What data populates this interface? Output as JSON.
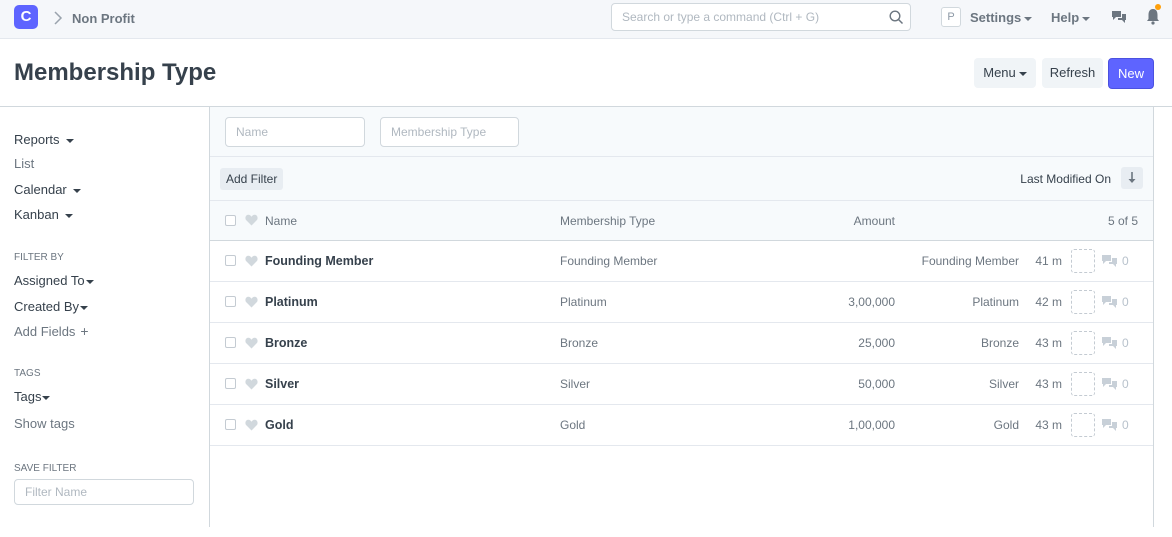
{
  "navbar": {
    "logo_letter": "C",
    "breadcrumb": "Non Profit",
    "search_placeholder": "Search or type a command (Ctrl + G)",
    "avatar_letter": "P",
    "settings_label": "Settings",
    "help_label": "Help",
    "icons": [
      "chevron-right-icon",
      "search-icon",
      "chat-icon",
      "bell-icon"
    ],
    "notification_dot_color": "#ffa00a"
  },
  "page": {
    "title": "Membership Type",
    "menu_label": "Menu",
    "refresh_label": "Refresh",
    "new_label": "New",
    "primary_color": "#5e64ff"
  },
  "sidebar": {
    "reports": "Reports",
    "list": "List",
    "calendar": "Calendar",
    "kanban": "Kanban",
    "filter_by_heading": "FILTER BY",
    "assigned_to": "Assigned To",
    "created_by": "Created By",
    "add_fields": "Add Fields",
    "tags_heading": "TAGS",
    "tags": "Tags",
    "show_tags": "Show tags",
    "save_filter_heading": "SAVE FILTER",
    "filter_name_placeholder": "Filter Name"
  },
  "filters": {
    "name_placeholder": "Name",
    "membership_type_placeholder": "Membership Type",
    "add_filter": "Add Filter",
    "sort_label": "Last Modified On"
  },
  "list": {
    "columns": {
      "name": "Name",
      "membership_type": "Membership Type",
      "amount": "Amount"
    },
    "count": "5 of 5",
    "rows": [
      {
        "name": "Founding Member",
        "membership_type": "Founding Member",
        "amount": "",
        "title": "Founding Member",
        "modified": "41 m",
        "comments": "0"
      },
      {
        "name": "Platinum",
        "membership_type": "Platinum",
        "amount": "3,00,000",
        "title": "Platinum",
        "modified": "42 m",
        "comments": "0"
      },
      {
        "name": "Bronze",
        "membership_type": "Bronze",
        "amount": "25,000",
        "title": "Bronze",
        "modified": "43 m",
        "comments": "0"
      },
      {
        "name": "Silver",
        "membership_type": "Silver",
        "amount": "50,000",
        "title": "Silver",
        "modified": "43 m",
        "comments": "0"
      },
      {
        "name": "Gold",
        "membership_type": "Gold",
        "amount": "1,00,000",
        "title": "Gold",
        "modified": "43 m",
        "comments": "0"
      }
    ]
  }
}
